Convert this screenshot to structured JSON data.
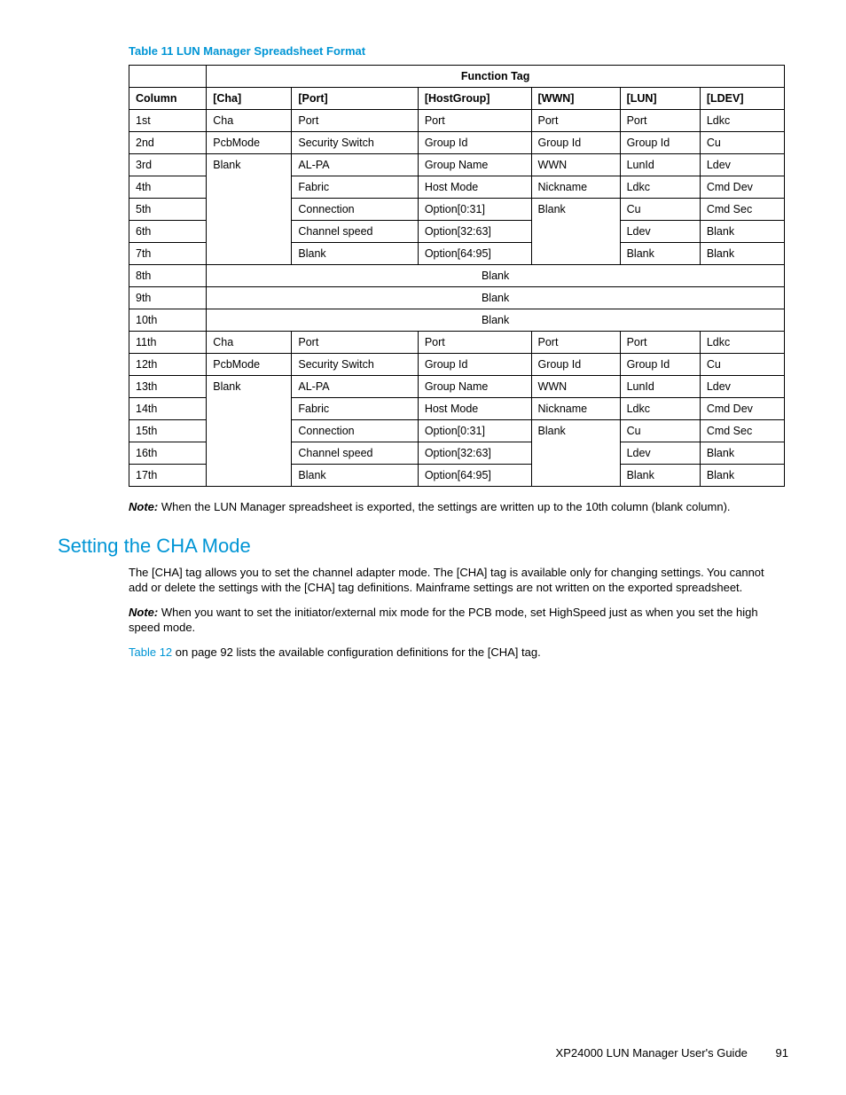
{
  "table_caption": "Table 11 LUN Manager Spreadsheet Format",
  "table": {
    "func_tag_label": "Function Tag",
    "headers": {
      "column": "Column",
      "cha": "[Cha]",
      "port": "[Port]",
      "hostgroup": "[HostGroup]",
      "wwn": "[WWN]",
      "lun": "[LUN]",
      "ldev": "[LDEV]"
    },
    "rows": {
      "r1": {
        "col": "1st",
        "cha": "Cha",
        "port": "Port",
        "hg": "Port",
        "wwn": "Port",
        "lun": "Port",
        "ldev": "Ldkc"
      },
      "r2": {
        "col": "2nd",
        "cha": "PcbMode",
        "port": "Security Switch",
        "hg": "Group Id",
        "wwn": "Group Id",
        "lun": "Group Id",
        "ldev": "Cu"
      },
      "r3": {
        "col": "3rd",
        "cha_merge": "Blank",
        "port": "AL-PA",
        "hg": "Group Name",
        "wwn": "WWN",
        "lun": "LunId",
        "ldev": "Ldev"
      },
      "r4": {
        "col": "4th",
        "port": "Fabric",
        "hg": "Host Mode",
        "wwn": "Nickname",
        "lun": "Ldkc",
        "ldev": "Cmd Dev"
      },
      "r5": {
        "col": "5th",
        "port": "Connection",
        "hg": "Option[0:31]",
        "wwn_merge": "Blank",
        "lun": "Cu",
        "ldev": "Cmd Sec"
      },
      "r6": {
        "col": "6th",
        "port": "Channel speed",
        "hg": "Option[32:63]",
        "lun": "Ldev",
        "ldev": "Blank"
      },
      "r7": {
        "col": "7th",
        "port": "Blank",
        "hg": "Option[64:95]",
        "lun": "Blank",
        "ldev": "Blank"
      },
      "r8": {
        "col": "8th",
        "merged": "Blank"
      },
      "r9": {
        "col": "9th",
        "merged": "Blank"
      },
      "r10": {
        "col": "10th",
        "merged": "Blank"
      },
      "r11": {
        "col": "11th",
        "cha": "Cha",
        "port": "Port",
        "hg": "Port",
        "wwn": "Port",
        "lun": "Port",
        "ldev": "Ldkc"
      },
      "r12": {
        "col": "12th",
        "cha": "PcbMode",
        "port": "Security Switch",
        "hg": "Group Id",
        "wwn": "Group Id",
        "lun": "Group Id",
        "ldev": "Cu"
      },
      "r13": {
        "col": "13th",
        "cha_merge": "Blank",
        "port": "AL-PA",
        "hg": "Group Name",
        "wwn": "WWN",
        "lun": "LunId",
        "ldev": "Ldev"
      },
      "r14": {
        "col": "14th",
        "port": "Fabric",
        "hg": "Host Mode",
        "wwn": "Nickname",
        "lun": "Ldkc",
        "ldev": "Cmd Dev"
      },
      "r15": {
        "col": "15th",
        "port": "Connection",
        "hg": "Option[0:31]",
        "wwn_merge": "Blank",
        "lun": "Cu",
        "ldev": "Cmd Sec"
      },
      "r16": {
        "col": "16th",
        "port": "Channel speed",
        "hg": "Option[32:63]",
        "lun": "Ldev",
        "ldev": "Blank"
      },
      "r17": {
        "col": "17th",
        "port": "Blank",
        "hg": "Option[64:95]",
        "lun": "Blank",
        "ldev": "Blank"
      }
    }
  },
  "note1_label": "Note:",
  "note1_text": " When the LUN Manager spreadsheet is exported, the settings are written up to the 10th column (blank column).",
  "section_heading": "Setting the CHA Mode",
  "para1": "The [CHA] tag allows you to set the channel adapter mode. The [CHA] tag is available only for changing settings. You cannot add or delete the settings with the [CHA] tag definitions. Mainframe settings are not written on the exported spreadsheet.",
  "note2_label": "Note:",
  "note2_text": " When you want to set the initiator/external mix mode for the PCB mode, set HighSpeed just as when you set the high speed mode.",
  "para2_link": "Table 12",
  "para2_rest": " on page 92 lists the available configuration definitions for the [CHA] tag.",
  "footer_title": "XP24000 LUN Manager User's Guide",
  "page_number": "91"
}
